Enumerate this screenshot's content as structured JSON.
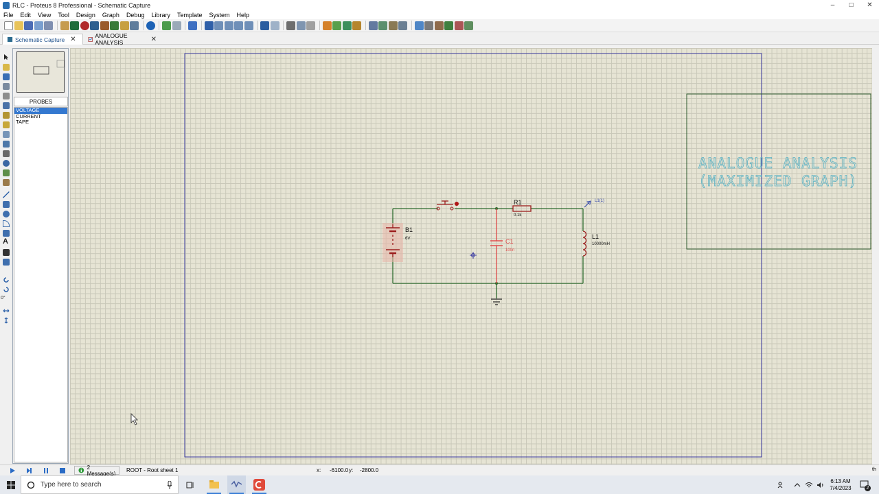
{
  "window": {
    "title": "RLC - Proteus 8 Professional - Schematic Capture",
    "min": "–",
    "max": "□",
    "close": "✕"
  },
  "menu": [
    "File",
    "Edit",
    "View",
    "Tool",
    "Design",
    "Graph",
    "Debug",
    "Library",
    "Template",
    "System",
    "Help"
  ],
  "tabs": [
    {
      "label": "Schematic Capture",
      "close": "✕"
    },
    {
      "label": "ANALOGUE ANALYSIS",
      "close": "✕"
    }
  ],
  "probes": {
    "header": "PROBES",
    "items": [
      "VOLTAGE",
      "CURRENT",
      "TAPE"
    ],
    "selected": "VOLTAGE"
  },
  "left_tools": {
    "rotation_angle": "0°"
  },
  "schematic": {
    "battery": {
      "ref": "B1",
      "value": "6V"
    },
    "resistor": {
      "ref": "R1",
      "value": "0.1k"
    },
    "capacitor": {
      "ref": "C1",
      "value": "100n"
    },
    "inductor": {
      "ref": "L1",
      "value": "10000mH"
    },
    "probe_label": "L1(1)",
    "graph": {
      "line1": "ANALOGUE ANALYSIS",
      "line2": "(MAXIMIZED GRAPH)"
    }
  },
  "status": {
    "messages": "2 Message(s)",
    "sheet": "ROOT - Root sheet 1",
    "x_label": "x:",
    "x_value": "-6100.0",
    "y_label": "y:",
    "y_value": "-2800.0",
    "th": "th"
  },
  "taskbar": {
    "search_placeholder": "Type here to search",
    "time": "6:13 AM",
    "date": "7/4/2023",
    "notif_count": "2"
  },
  "colors": {
    "wire": "#2e6b2e",
    "component": "#9b1c1c",
    "selected_component": "#e04c4c",
    "graph_text": "#5fb3c4",
    "sheet_border": "#3a3aa0"
  }
}
